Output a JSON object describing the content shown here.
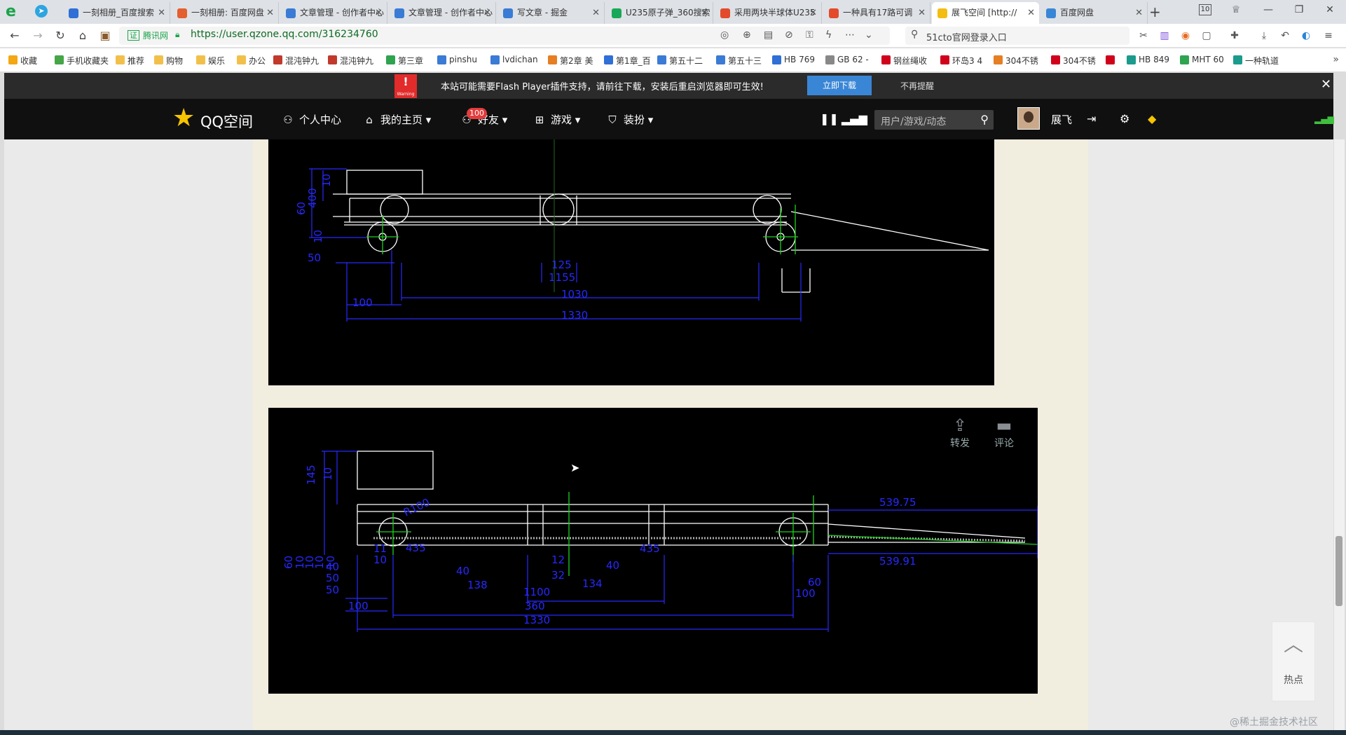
{
  "tabs": [
    {
      "label": "一刻相册_百度搜索",
      "fav_color": "#2f6fd6"
    },
    {
      "label": "一刻相册: 百度网盘",
      "fav_color": "#e35f2f"
    },
    {
      "label": "文章管理 - 创作者中心",
      "fav_color": "#3a7bd5"
    },
    {
      "label": "文章管理 - 创作者中心",
      "fav_color": "#3a7bd5"
    },
    {
      "label": "写文章 - 掘金",
      "fav_color": "#3a7bd5"
    },
    {
      "label": "U235原子弹_360搜索",
      "fav_color": "#19a857"
    },
    {
      "label": "采用两块半球体U235",
      "fav_color": "#e24a2b"
    },
    {
      "label": "一种具有17路可调",
      "fav_color": "#e24a2b"
    },
    {
      "label": "展飞空间 [http://",
      "fav_color": "#f3bd12"
    },
    {
      "label": "百度网盘",
      "fav_color": "#3a86d6"
    }
  ],
  "tab_count": "10",
  "address": {
    "tag": "证",
    "site": "腾讯网",
    "url": "https://user.qzone.qq.com/316234760",
    "search_text": "51cto官网登录入口"
  },
  "bookmarks": [
    {
      "label": "收藏",
      "color": "#f3a712"
    },
    {
      "label": "手机收藏夹",
      "color": "#46a546"
    },
    {
      "label": "推荐",
      "color": "#f2c04a"
    },
    {
      "label": "购物",
      "color": "#f2c04a"
    },
    {
      "label": "娱乐",
      "color": "#f2c04a"
    },
    {
      "label": "办公",
      "color": "#f2c04a"
    },
    {
      "label": "混沌钟九",
      "color": "#c0392b"
    },
    {
      "label": "混沌钟九",
      "color": "#c0392b"
    },
    {
      "label": "第三章",
      "color": "#2ea44f"
    },
    {
      "label": "pinshu",
      "color": "#3a7bd5"
    },
    {
      "label": "lvdichan",
      "color": "#3a7bd5"
    },
    {
      "label": "第2章 美",
      "color": "#e67e22"
    },
    {
      "label": "第1章_百",
      "color": "#2f6fd6"
    },
    {
      "label": "第五十二",
      "color": "#3a7bd5"
    },
    {
      "label": "第五十三",
      "color": "#3a7bd5"
    },
    {
      "label": "HB 769",
      "color": "#2f6fd6"
    },
    {
      "label": "GB 62 -",
      "color": "#888888"
    },
    {
      "label": "钢丝绳收",
      "color": "#d0021b"
    },
    {
      "label": "环岛3 4",
      "color": "#d0021b"
    },
    {
      "label": "304不锈",
      "color": "#e67e22"
    },
    {
      "label": "304不锈",
      "color": "#d0021b"
    },
    {
      "label": "",
      "color": "#d0021b"
    },
    {
      "label": "HB 849",
      "color": "#1a9b8c"
    },
    {
      "label": "MHT 60",
      "color": "#2ea44f"
    },
    {
      "label": "一种轨道",
      "color": "#1a9b8c"
    }
  ],
  "flash": {
    "icon_text": "Warning",
    "message": "本站可能需要Flash Player插件支持，请前往下载，安装后重启浏览器即可生效!",
    "download": "立即下载",
    "dismiss": "不再提醒"
  },
  "qzone_nav": {
    "logo": "QQ空间",
    "personal": "个人中心",
    "home": "我的主页",
    "friends": "好友",
    "friends_badge": "100",
    "games": "游戏",
    "dress": "装扮",
    "search_placeholder": "用户/游戏/动态",
    "username": "展飞"
  },
  "post": {
    "share": "转发",
    "comment": "评论"
  },
  "hotspot": {
    "label": "热点"
  },
  "watermark": "@稀土掘金技术社区",
  "drawing1": {
    "dims_bottom": [
      "50",
      "100",
      "1030",
      "1330",
      "125",
      "1155"
    ],
    "dims_left": [
      "60",
      "400",
      "10",
      "10"
    ]
  },
  "drawing2": {
    "dims_top": [
      "145",
      "10"
    ],
    "dims_bottom": [
      "435",
      "40",
      "138",
      "12",
      "32",
      "40",
      "134",
      "435",
      "100",
      "360",
      "1100",
      "1330",
      "100",
      "50",
      "40",
      "50",
      "10",
      "11"
    ],
    "dims_right": [
      "539.75",
      "539.91",
      "60"
    ],
    "dims_left": [
      "60",
      "10",
      "10",
      "10",
      "10"
    ],
    "radius": "R100"
  }
}
